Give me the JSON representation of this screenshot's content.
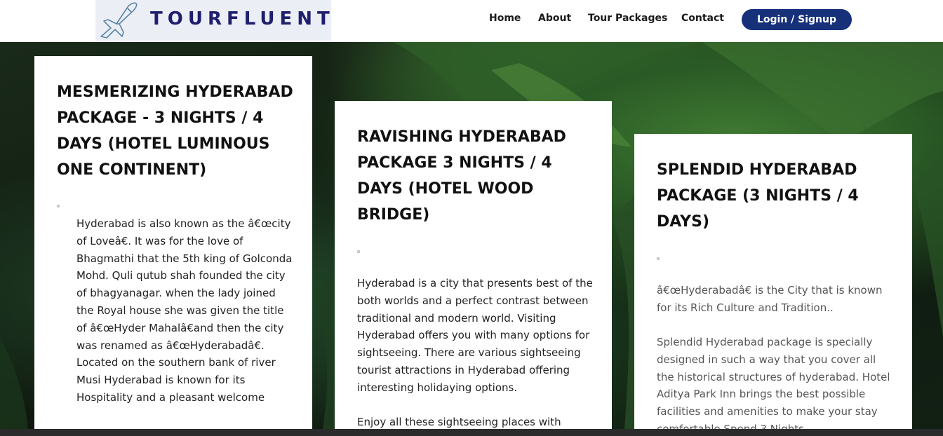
{
  "header": {
    "logo_text": "TOURFLUENT",
    "logo_icon": "airplane-icon",
    "nav": [
      "Home",
      "About",
      "Tour Packages",
      "Contact"
    ],
    "login_label": "Login / Signup",
    "colors": {
      "brand": "#1f1f6e",
      "button": "#16307a"
    }
  },
  "cards": [
    {
      "title": "MESMERIZING HYDERABAD PACKAGE - 3 NIGHTS / 4 DAYS (HOTEL LUMINOUS ONE CONTINENT)",
      "paragraphs": [
        "Hyderabad is also known as the â€œcity of Loveâ€. It was for the love of Bhagmathi that the 5th king of Golconda Mohd. Quli qutub shah founded the city of bhagyanagar. when the lady joined the Royal house she was given the title of â€œHyder Mahalâ€and then the city was renamed as â€œHyderabadâ€. Located on the southern bank of river Musi Hyderabad is known for its Hospitality and a pleasant welcome"
      ]
    },
    {
      "title": "RAVISHING HYDERABAD PACKAGE 3 NIGHTS / 4 DAYS  (HOTEL WOOD BRIDGE)",
      "paragraphs": [
        "Hyderabad is a city that presents best of the both worlds and a perfect contrast between traditional and modern world. Visiting Hyderabad offers you with many options for sightseeing. There are various sightseeing tourist attractions in Hyderabad offering interesting holidaying options.",
        "Enjoy all these sightseeing places with"
      ]
    },
    {
      "title": "SPLENDID HYDERABAD PACKAGE (3 NIGHTS / 4 DAYS)",
      "paragraphs": [
        "â€œHyderabadâ€ is the City that is known for its Rich Culture and Tradition..",
        "Splendid Hyderabad package is specially designed in such a way that you cover all the historical structures of hyderabad. Hotel Aditya Park Inn brings the best possible facilities and amenities to make your stay comfortable.Spend 3 Nights"
      ]
    }
  ]
}
